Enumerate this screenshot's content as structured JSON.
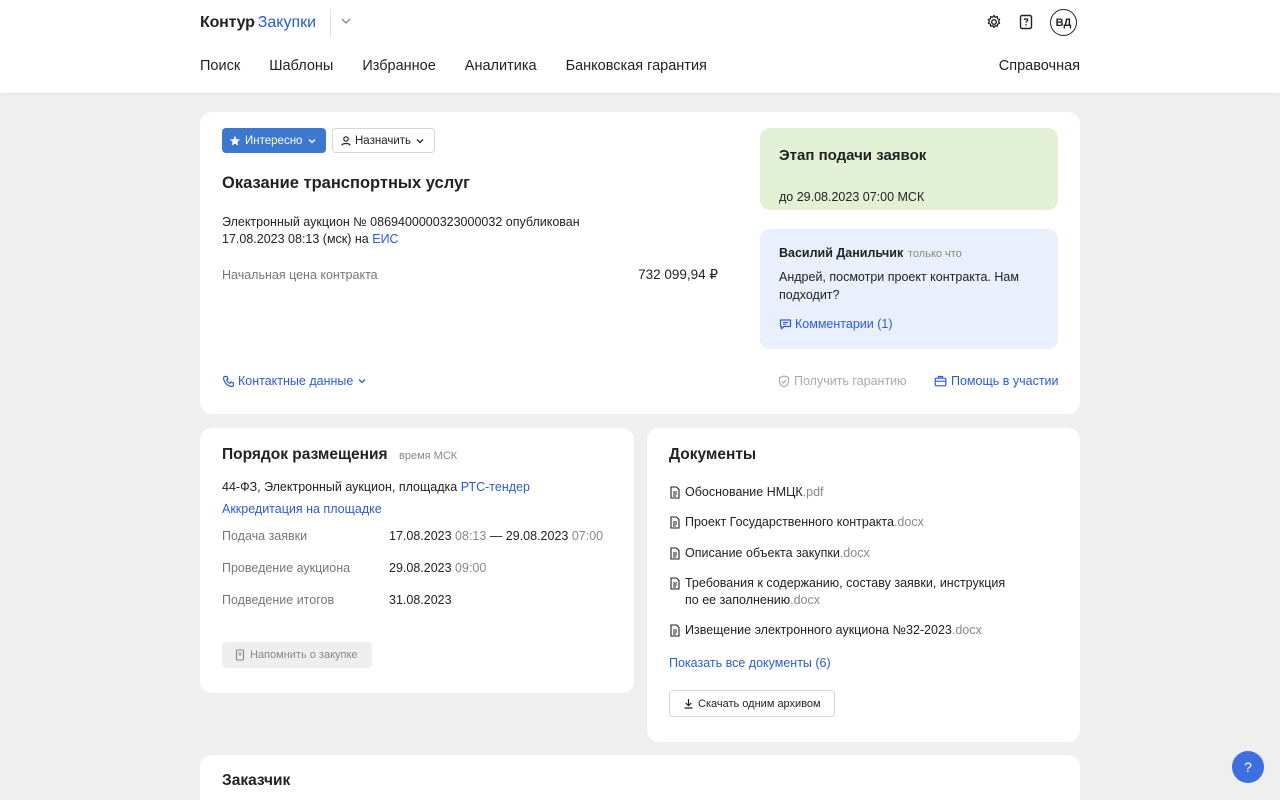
{
  "header": {
    "logo_main": "Контур",
    "logo_product": "Закупки",
    "avatar_initials": "ВД",
    "nav": [
      "Поиск",
      "Шаблоны",
      "Избранное",
      "Аналитика",
      "Банковская гарантия"
    ],
    "nav_right": "Справочная"
  },
  "main": {
    "interesno_label": "Интересно",
    "naznachit_label": "Назначить",
    "title": "Оказание транспортных услуг",
    "auction_line1": "Электронный аукцион № 0869400000323000032 опубликован",
    "auction_line2": "17.08.2023 08:13 (мск) на ",
    "eis_link": "ЕИС",
    "price_label": "Начальная цена контракта",
    "price_value": "732 099,94 ₽",
    "contacts_label": "Контактные данные",
    "guarantee_label": "Получить гарантию",
    "help_label": "Помощь в участии",
    "stage": {
      "title": "Этап подачи заявок",
      "date": "до 29.08.2023 07:00 МСК"
    },
    "comment": {
      "author": "Василий Данильчик",
      "time": "только что",
      "text": "Андрей, посмотри проект контракта. Нам подходит?",
      "link": "Комментарии (1)"
    }
  },
  "order": {
    "title": "Порядок размещения",
    "subtitle": "время МСК",
    "law_text": "44-ФЗ, Электронный аукцион, площадка ",
    "platform_link": "РТС-тендер",
    "accreditation_link": "Аккредитация на площадке",
    "rows": [
      {
        "label": "Подача заявки",
        "date1": "17.08.2023",
        "time1": "08:13",
        "sep": "—",
        "date2": "29.08.2023",
        "time2": "07:00"
      },
      {
        "label": "Проведение аукциона",
        "date1": "29.08.2023",
        "time1": "09:00"
      },
      {
        "label": "Подведение итогов",
        "date1": "31.08.2023"
      }
    ],
    "remind_label": "Напомнить о закупке"
  },
  "documents": {
    "title": "Документы",
    "items": [
      {
        "name": "Обоснование НМЦК",
        "ext": ".pdf"
      },
      {
        "name": "Проект Государственного контракта",
        "ext": ".docx"
      },
      {
        "name": "Описание объекта закупки",
        "ext": ".docx"
      },
      {
        "name_line1": "Требования к содержанию, составу заявки, инструкция",
        "name_line2": "по ее заполнению",
        "ext": ".docx"
      },
      {
        "name": "Извещение электронного аукциона №32-2023",
        "ext": ".docx"
      }
    ],
    "show_all": "Показать все документы (6)",
    "download_label": "Скачать одним архивом"
  },
  "customer": {
    "title": "Заказчик"
  },
  "help_fab": "?"
}
